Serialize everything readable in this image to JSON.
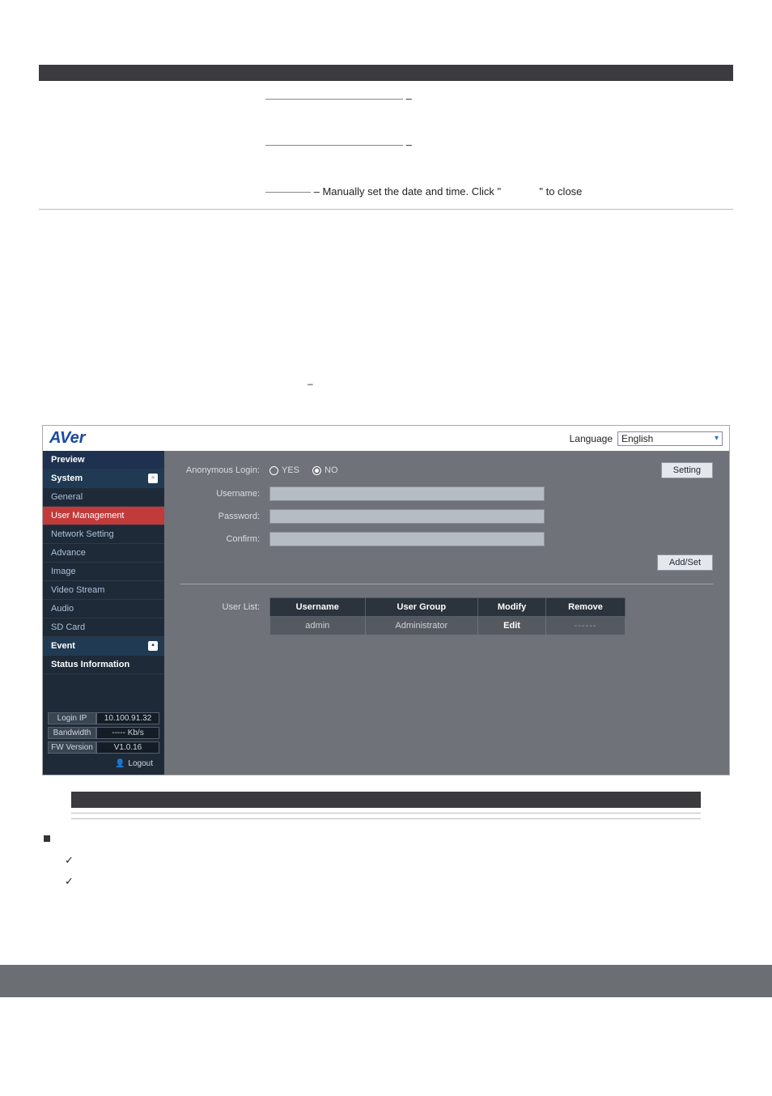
{
  "header_text": {
    "manual_line_prefix": " – Manually set the date and time. Click \"",
    "manual_line_suffix": "\" to close",
    "dash": " – "
  },
  "app": {
    "logo_a": "A",
    "logo_ver": "Ver",
    "language_label": "Language",
    "language_value": "English"
  },
  "sidebar": {
    "preview": "Preview",
    "system": "System",
    "general": "General",
    "user_mgmt": "User Management",
    "network": "Network Setting",
    "advance": "Advance",
    "image": "Image",
    "video_stream": "Video Stream",
    "audio": "Audio",
    "sd_card": "SD Card",
    "event": "Event",
    "status_info": "Status Information"
  },
  "status": {
    "login_ip_label": "Login IP",
    "login_ip_value": "10.100.91.32",
    "bandwidth_label": "Bandwidth",
    "bandwidth_value": "----- Kb/s",
    "fw_label": "FW Version",
    "fw_value": "V1.0.16",
    "logout": "Logout"
  },
  "form": {
    "anon_login": "Anonymous Login:",
    "yes": "YES",
    "no": "NO",
    "setting": "Setting",
    "username": "Username:",
    "password": "Password:",
    "confirm": "Confirm:",
    "addset": "Add/Set",
    "user_list": "User List:"
  },
  "table": {
    "col_username": "Username",
    "col_usergroup": "User Group",
    "col_modify": "Modify",
    "col_remove": "Remove",
    "row1_user": "admin",
    "row1_group": "Administrator",
    "row1_modify": "Edit",
    "row1_remove": "------"
  },
  "bottom": {
    "dash_only": " – "
  }
}
